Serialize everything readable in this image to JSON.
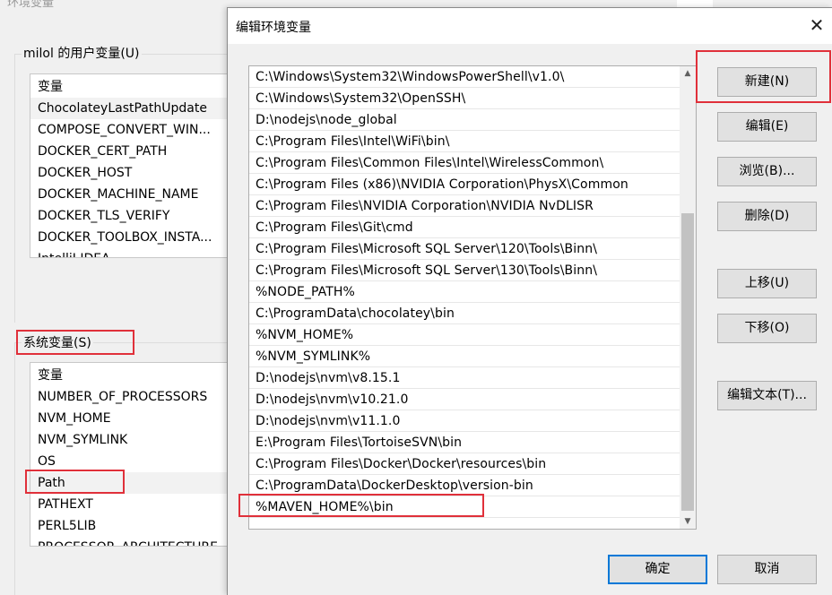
{
  "background_window": {
    "title": "环境变量",
    "user_vars_label": "milol 的用户变量(U)",
    "user_vars_header": "变量",
    "user_vars": [
      "ChocolateyLastPathUpdate",
      "COMPOSE_CONVERT_WIN...",
      "DOCKER_CERT_PATH",
      "DOCKER_HOST",
      "DOCKER_MACHINE_NAME",
      "DOCKER_TLS_VERIFY",
      "DOCKER_TOOLBOX_INSTA...",
      "IntelliJ IDEA"
    ],
    "system_vars_label": "系统变量(S)",
    "system_vars_header": "变量",
    "system_vars": [
      "NUMBER_OF_PROCESSORS",
      "NVM_HOME",
      "NVM_SYMLINK",
      "OS",
      "Path",
      "PATHEXT",
      "PERL5LIB",
      "PROCESSOR_ARCHITECTURE"
    ]
  },
  "dialog": {
    "title": "编辑环境变量",
    "close_glyph": "✕",
    "path_entries": [
      "C:\\Windows\\System32\\WindowsPowerShell\\v1.0\\",
      "C:\\Windows\\System32\\OpenSSH\\",
      "D:\\nodejs\\node_global",
      "C:\\Program Files\\Intel\\WiFi\\bin\\",
      "C:\\Program Files\\Common Files\\Intel\\WirelessCommon\\",
      "C:\\Program Files (x86)\\NVIDIA Corporation\\PhysX\\Common",
      "C:\\Program Files\\NVIDIA Corporation\\NVIDIA NvDLISR",
      "C:\\Program Files\\Git\\cmd",
      "C:\\Program Files\\Microsoft SQL Server\\120\\Tools\\Binn\\",
      "C:\\Program Files\\Microsoft SQL Server\\130\\Tools\\Binn\\",
      "%NODE_PATH%",
      "C:\\ProgramData\\chocolatey\\bin",
      "%NVM_HOME%",
      "%NVM_SYMLINK%",
      "D:\\nodejs\\nvm\\v8.15.1",
      "D:\\nodejs\\nvm\\v10.21.0",
      "D:\\nodejs\\nvm\\v11.1.0",
      "E:\\Program Files\\TortoiseSVN\\bin",
      "C:\\Program Files\\Docker\\Docker\\resources\\bin",
      "C:\\ProgramData\\DockerDesktop\\version-bin",
      "%MAVEN_HOME%\\bin"
    ],
    "buttons": {
      "new": "新建(N)",
      "edit": "编辑(E)",
      "browse": "浏览(B)...",
      "delete": "删除(D)",
      "move_up": "上移(U)",
      "move_down": "下移(O)",
      "edit_text": "编辑文本(T)...",
      "ok": "确定",
      "cancel": "取消"
    },
    "scroll_up_glyph": "▲",
    "scroll_down_glyph": "▼"
  },
  "colors": {
    "highlight_red": "#e0303a",
    "primary_border": "#0078d7"
  }
}
